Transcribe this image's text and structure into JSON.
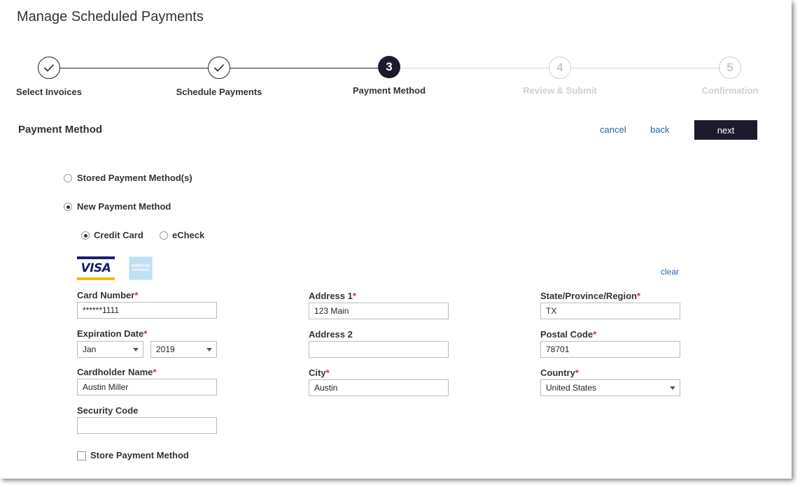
{
  "page": {
    "title": "Manage Scheduled Payments"
  },
  "stepper": {
    "steps": [
      {
        "number": "1",
        "label": "Select Invoices",
        "state": "done",
        "icon": "checkmark-icon"
      },
      {
        "number": "2",
        "label": "Schedule Payments",
        "state": "done",
        "icon": "checkmark-icon"
      },
      {
        "number": "3",
        "label": "Payment Method",
        "state": "active"
      },
      {
        "number": "4",
        "label": "Review & Submit",
        "state": "future"
      },
      {
        "number": "5",
        "label": "Confirmation",
        "state": "future"
      }
    ]
  },
  "section": {
    "title": "Payment Method"
  },
  "actions": {
    "cancel": "cancel",
    "back": "back",
    "next": "next"
  },
  "payment_options": {
    "stored": {
      "label": "Stored Payment Method(s)",
      "checked": false
    },
    "new": {
      "label": "New Payment Method",
      "checked": true
    }
  },
  "payment_types": {
    "credit_card": {
      "label": "Credit Card",
      "checked": true
    },
    "echeck": {
      "label": "eCheck",
      "checked": false
    }
  },
  "cards": {
    "visa": "VISA",
    "amex": "AMERICAN EXPRESS",
    "clear": "clear"
  },
  "form": {
    "card_number": {
      "label": "Card Number",
      "required": "*",
      "value": "******1111"
    },
    "expiration": {
      "label": "Expiration Date",
      "required": "*",
      "month": "Jan",
      "year": "2019"
    },
    "cardholder": {
      "label": "Cardholder Name",
      "required": "*",
      "value": "Austin Miller"
    },
    "security_code": {
      "label": "Security Code",
      "value": ""
    },
    "address1": {
      "label": "Address 1",
      "required": "*",
      "value": "123 Main"
    },
    "address2": {
      "label": "Address 2",
      "value": ""
    },
    "city": {
      "label": "City",
      "required": "*",
      "value": "Austin"
    },
    "state": {
      "label": "State/Province/Region",
      "required": "*",
      "value": "TX"
    },
    "postal": {
      "label": "Postal Code",
      "required": "*",
      "value": "78701"
    },
    "country": {
      "label": "Country",
      "required": "*",
      "value": "United States"
    },
    "store": {
      "label": "Store Payment Method",
      "checked": false
    }
  },
  "colors": {
    "primary": "#1c1b2e",
    "link": "#2a5fa5",
    "required": "#c0392b",
    "inactive": "#cfcfcf"
  }
}
